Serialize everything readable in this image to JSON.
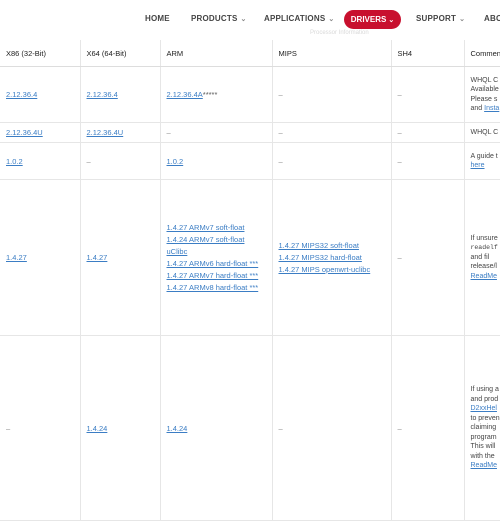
{
  "nav": {
    "items": [
      {
        "label": "HOME",
        "caret": false
      },
      {
        "label": "PRODUCTS",
        "caret": true
      },
      {
        "label": "APPLICATIONS",
        "caret": true
      },
      {
        "label": "DRIVERS",
        "caret": true,
        "active": true
      },
      {
        "label": "SUPPORT",
        "caret": true
      },
      {
        "label": "ABO",
        "caret": false
      }
    ],
    "caret_glyph": "⌄",
    "active_color": "#c8102e",
    "ghost_text": "Processor Information"
  },
  "table": {
    "headers": [
      "X86 (32-Bit)",
      "X64 (64-Bit)",
      "ARM",
      "MIPS",
      "SH4",
      "Commen"
    ],
    "rows": [
      {
        "x86": "2.12.36.4",
        "x64": "2.12.36.4",
        "arm": "2.12.36.4A",
        "arm_suffix": "*****",
        "mips": "–",
        "sh4": "–",
        "comment": [
          "WHQL C",
          "Available",
          "Please s",
          "and "
        ],
        "comment_link": "Insta"
      },
      {
        "x86": "2.12.36.4U",
        "x64": "2.12.36.4U",
        "arm": "–",
        "mips": "–",
        "sh4": "–",
        "comment": [
          "WHQL C"
        ]
      },
      {
        "x86": "1.0.2",
        "x64": "–",
        "arm": "1.0.2",
        "mips": "–",
        "sh4": "–",
        "comment": [
          "A guide t"
        ],
        "comment_link": "here"
      },
      {
        "x86": "1.4.27",
        "x64": "1.4.27",
        "arm_list": [
          "1.4.27 ARMv7 soft-float",
          "1.4.24 ARMv7 soft-float",
          "uClibc",
          "1.4.27 ARMv6 hard-float ***",
          "1.4.27 ARMv7 hard-float ***",
          "1.4.27 ARMv8 hard-float ***"
        ],
        "mips_list": [
          "1.4.27 MIPS32 soft-float",
          "1.4.27 MIPS32 hard-float",
          "1.4.27 MIPS openwrt-uclibc"
        ],
        "sh4": "–",
        "comment": [
          "If unsure",
          "readelf",
          "and fil",
          "release/l"
        ],
        "comment_link": "ReadMe"
      },
      {
        "x86": "–",
        "x64": "1.4.24",
        "arm": "1.4.24",
        "mips": "–",
        "sh4": "–",
        "comment": [
          "If using a",
          "and prod",
          "D2xxHel",
          "to preven",
          "claiming",
          "program",
          "This will",
          "with the"
        ],
        "comment_link": "ReadMe"
      }
    ]
  }
}
